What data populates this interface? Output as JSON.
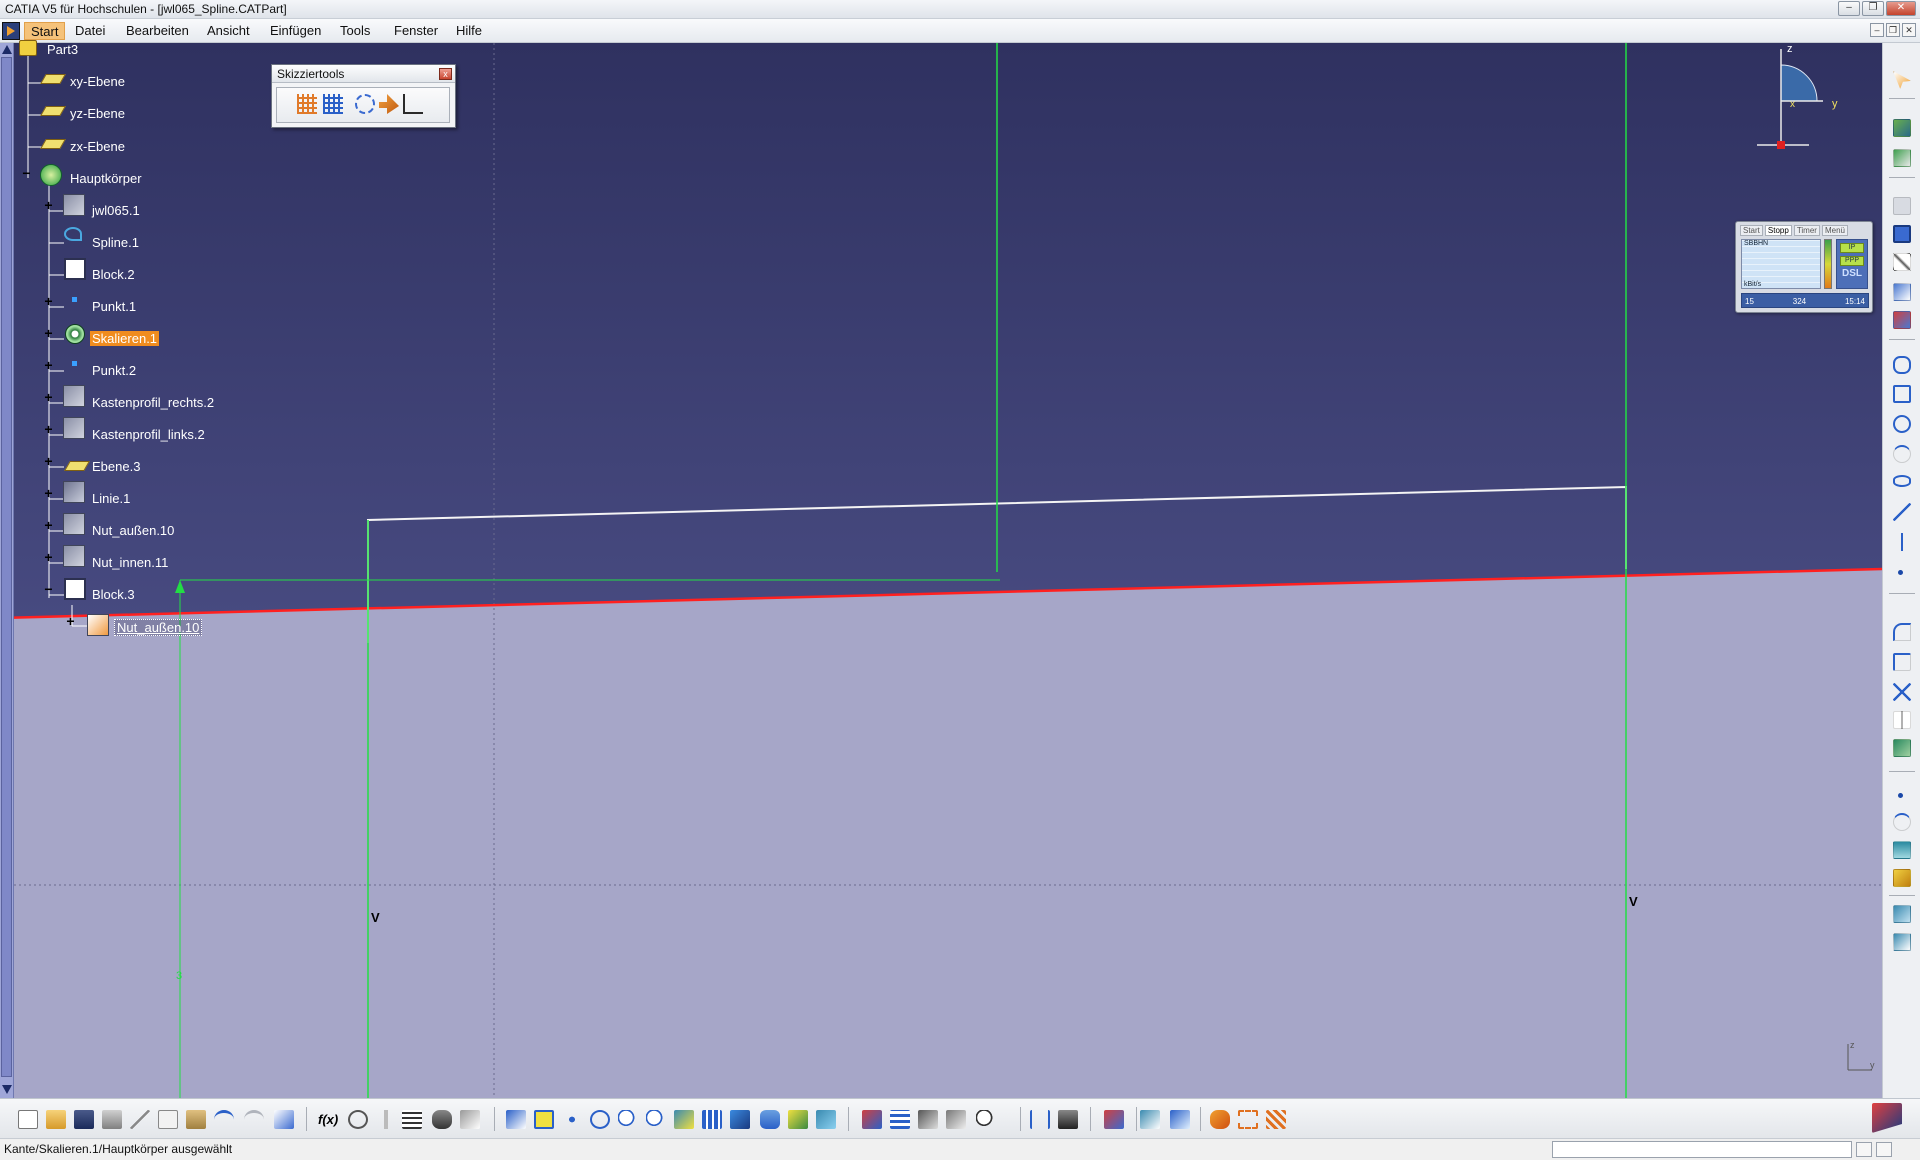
{
  "window": {
    "title": "CATIA V5 für Hochschulen - [jwl065_Spline.CATPart]"
  },
  "menu": [
    "Start",
    "Datei",
    "Bearbeiten",
    "Ansicht",
    "Einfügen",
    "Tools",
    "Fenster",
    "Hilfe"
  ],
  "skizziertools": {
    "title": "Skizziertools"
  },
  "tree": {
    "root": "Part3",
    "items": [
      "xy-Ebene",
      "yz-Ebene",
      "zx-Ebene",
      "Hauptkörper",
      "jwl065.1",
      "Spline.1",
      "Block.2",
      "Punkt.1",
      "Skalieren.1",
      "Punkt.2",
      "Kastenprofil_rechts.2",
      "Kastenprofil_links.2",
      "Ebene.3",
      "Linie.1",
      "Nut_außen.10",
      "Nut_innen.11",
      "Block.3",
      "Nut_außen.10"
    ],
    "selected": "Skalieren.1"
  },
  "viewport": {
    "markers": [
      "V",
      "V",
      "3"
    ],
    "colors": {
      "upper": "#363866",
      "lower": "#a6a6c8",
      "profile": "#ff2020",
      "sketch": "#22dd44"
    }
  },
  "compass": [
    "z",
    "y",
    "x"
  ],
  "dsl_widget": {
    "tabs": [
      "Start",
      "Stopp",
      "Timer",
      "Menü"
    ],
    "box1": "IP",
    "box2": "PPP",
    "brand": "DSL",
    "graph_top": "SBBHN",
    "graph_bottom": "kBit/s",
    "sent": "15",
    "received": "324",
    "time": "15:14"
  },
  "status": {
    "text": "Kante/Skalieren.1/Hauptkörper ausgewählt"
  }
}
